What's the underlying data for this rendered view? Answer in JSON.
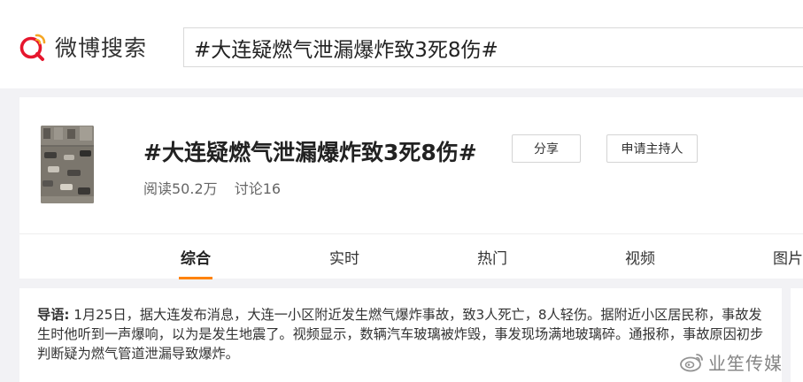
{
  "header": {
    "logo_text": "微博搜索",
    "search_value": "#大连疑燃气泄漏爆炸致3死8伤#",
    "brand_color": "#e6162d"
  },
  "topic": {
    "title": "#大连疑燃气泄漏爆炸致3死8伤#",
    "reads": "阅读50.2万",
    "discussions": "讨论16",
    "share_label": "分享",
    "host_label": "申请主持人"
  },
  "tabs": [
    {
      "label": "综合",
      "active": true
    },
    {
      "label": "实时",
      "active": false
    },
    {
      "label": "热门",
      "active": false
    },
    {
      "label": "视频",
      "active": false
    },
    {
      "label": "图片",
      "active": false
    }
  ],
  "lead": {
    "label": "导语:",
    "text": "1月25日，据大连发布消息，大连一小区附近发生燃气爆炸事故，致3人死亡，8人轻伤。据附近小区居民称，事故发生时他听到一声爆响，以为是发生地震了。视频显示，数辆汽车玻璃被炸毁，事发现场满地玻璃碎。通报称，事故原因初步判断疑为燃气管道泄漏导致爆炸。"
  },
  "watermark": {
    "text": "业笙传媒",
    "icon": "weibo-icon"
  },
  "accent_color": "#ff8200"
}
